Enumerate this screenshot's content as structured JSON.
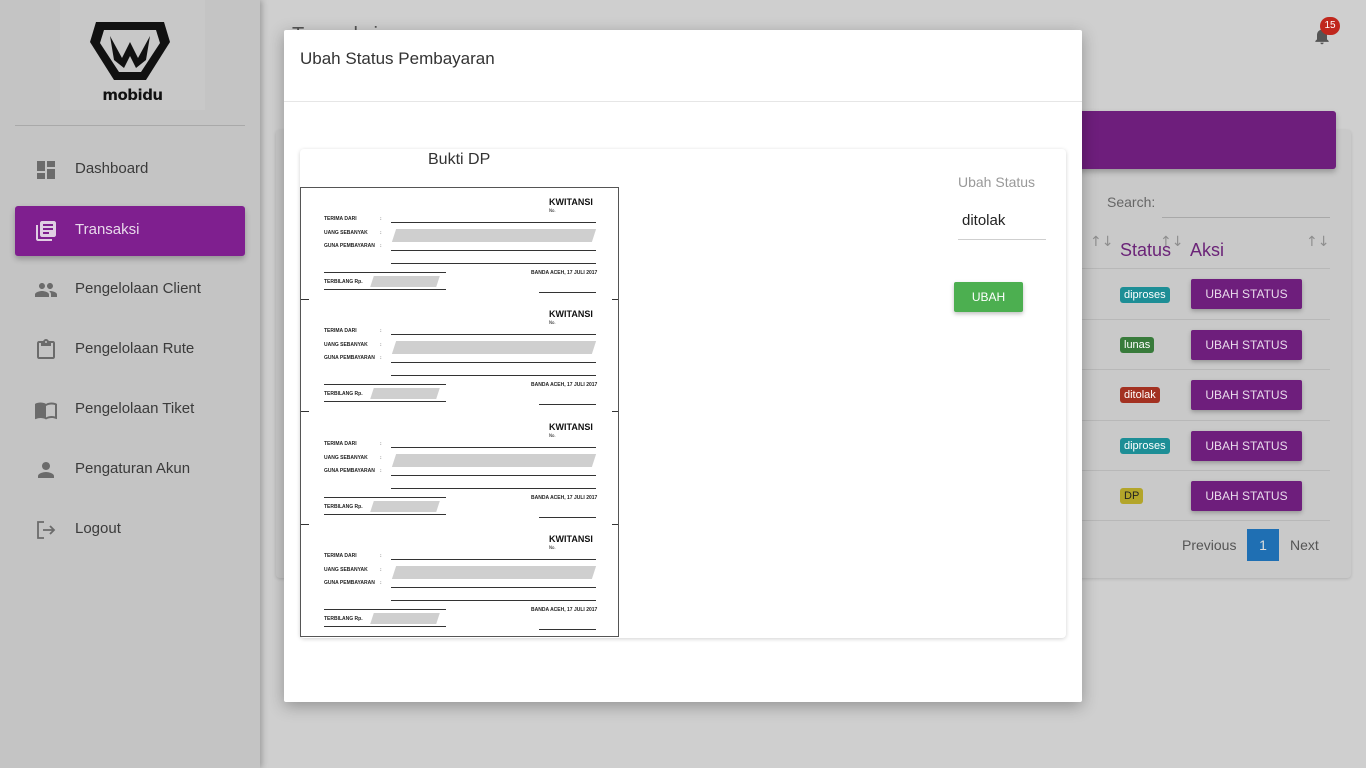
{
  "app": {
    "brand": "mobidu",
    "notifications": "15",
    "page_title": "Transaksi",
    "accent": "#7f1f8f"
  },
  "sidebar": {
    "items": [
      {
        "label": "Dashboard",
        "icon": "dashboard-icon",
        "active": false
      },
      {
        "label": "Transaksi",
        "icon": "library-books-icon",
        "active": true
      },
      {
        "label": "Pengelolaan Client",
        "icon": "people-icon",
        "active": false
      },
      {
        "label": "Pengelolaan Rute",
        "icon": "clipboard-icon",
        "active": false
      },
      {
        "label": "Pengelolaan Tiket",
        "icon": "book-icon",
        "active": false
      },
      {
        "label": "Pengaturan Akun",
        "icon": "person-icon",
        "active": false
      },
      {
        "label": "Logout",
        "icon": "logout-icon",
        "active": false
      }
    ]
  },
  "table": {
    "search_label": "Search:",
    "headers": {
      "status": "Status",
      "aksi": "Aksi"
    },
    "rows": [
      {
        "status": "diproses",
        "status_color": "#1aa3a3",
        "action": "UBAH STATUS"
      },
      {
        "status": "lunas",
        "status_color": "#3b8f3f",
        "action": "UBAH STATUS"
      },
      {
        "status": "ditolak",
        "status_color": "#b8311f",
        "action": "UBAH STATUS"
      },
      {
        "status": "diproses",
        "status_color": "#1aa3a3",
        "action": "UBAH STATUS"
      },
      {
        "status": "DP",
        "status_color": "#c9b92a",
        "action": "UBAH STATUS"
      }
    ],
    "pagination": {
      "previous": "Previous",
      "page": "1",
      "next": "Next"
    }
  },
  "modal": {
    "title": "Ubah Status Pembayaran",
    "bukti_title": "Bukti DP",
    "status_label": "Ubah Status",
    "status_value": "ditolak",
    "submit": "UBAH",
    "receipt": {
      "title": "KWITANSI",
      "no": "No.",
      "terima": "TERIMA DARI",
      "uang": "UANG SEBANYAK",
      "guna": "GUNA PEMBAYARAN",
      "date": "BANDA ACEH, 17 JULI 2017",
      "terbilang": "TERBILANG Rp.",
      "colon": ":"
    }
  }
}
